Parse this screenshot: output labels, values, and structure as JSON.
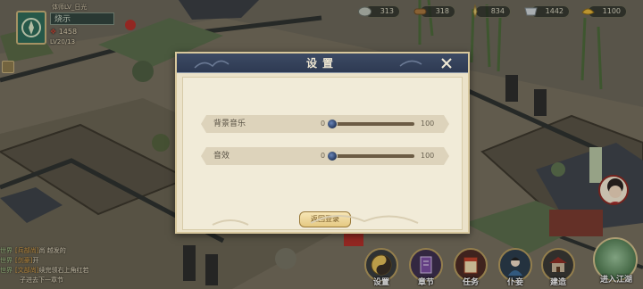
{
  "player": {
    "top_label": "体师LV_日光",
    "name": "烧示",
    "power": "1458",
    "level": "LV20/13"
  },
  "resources": [
    {
      "icon": "silver-icon",
      "value": "313"
    },
    {
      "icon": "wood-icon",
      "value": "318"
    },
    {
      "icon": "grain-icon",
      "value": "834"
    },
    {
      "icon": "cloth-icon",
      "value": "1442"
    },
    {
      "icon": "gold-icon",
      "value": "1100"
    }
  ],
  "settings": {
    "title": "设置",
    "bgm": {
      "label": "背景音乐",
      "min": "0",
      "max": "100",
      "value": 0
    },
    "sfx": {
      "label": "音效",
      "min": "0",
      "max": "100",
      "value": 0
    },
    "return_label": "返回登录"
  },
  "chat": [
    {
      "channel": "世界",
      "who": "[兵部尚]",
      "text": "尚 越发的"
    },
    {
      "channel": "世界",
      "who": "[剑豪]",
      "text": "开"
    },
    {
      "channel": "世界",
      "who": "[文部尚]",
      "text": "续完领右上角红若"
    },
    {
      "channel": "",
      "who": "",
      "text": "子进去下一章节"
    }
  ],
  "menu": [
    {
      "name": "settings",
      "icon": "yinyang-icon",
      "label": "设置"
    },
    {
      "name": "chapter",
      "icon": "chapter-icon",
      "label": "章节"
    },
    {
      "name": "tasks",
      "icon": "task-icon",
      "label": "任务"
    },
    {
      "name": "retainers",
      "icon": "retainer-icon",
      "label": "仆妾"
    },
    {
      "name": "build",
      "icon": "building-icon",
      "label": "建造"
    }
  ],
  "enter_jianghu": "进入江湖"
}
